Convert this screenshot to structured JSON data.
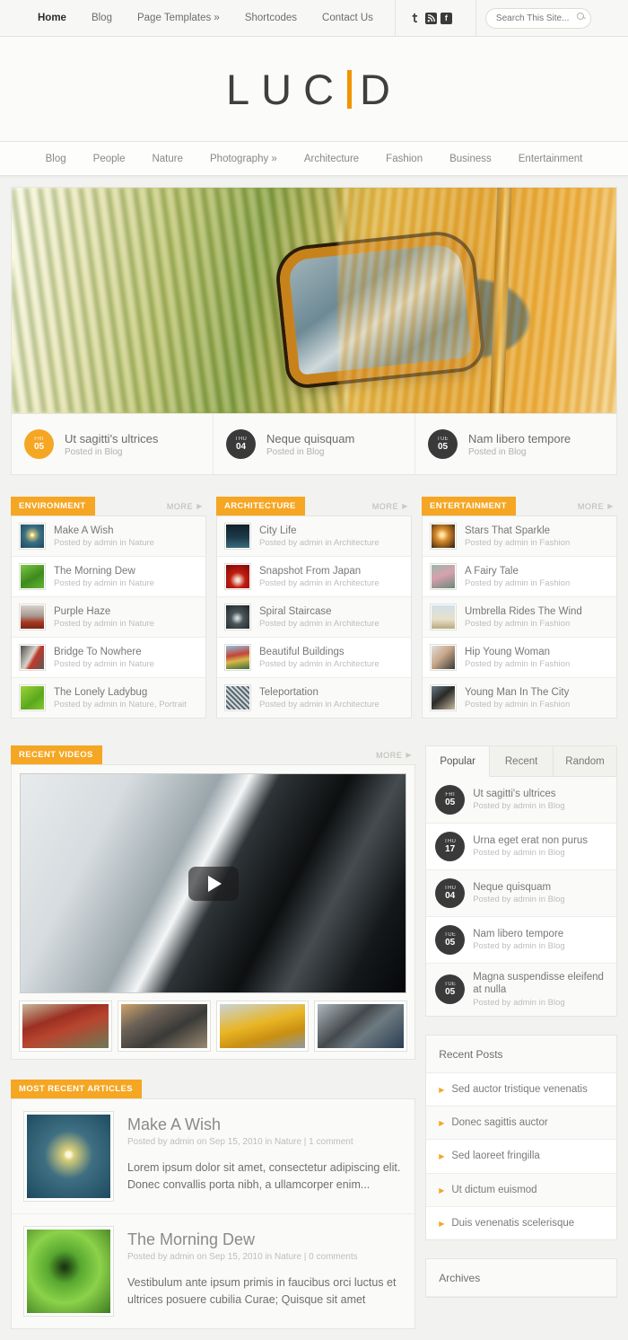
{
  "topnav": {
    "items": [
      {
        "label": "Home",
        "active": true
      },
      {
        "label": "Blog",
        "active": false
      },
      {
        "label": "Page Templates »",
        "active": false
      },
      {
        "label": "Shortcodes",
        "active": false
      },
      {
        "label": "Contact Us",
        "active": false
      }
    ],
    "social": [
      "twitter-icon",
      "rss-icon",
      "facebook-icon"
    ],
    "social_glyphs": [
      "t",
      "◤",
      "f"
    ]
  },
  "search": {
    "placeholder": "Search This Site...",
    "value": ""
  },
  "logo": {
    "before": "LUC",
    "after": "D",
    "bar": "I",
    "accent": "#f29400"
  },
  "catnav": {
    "items": [
      "Blog",
      "People",
      "Nature",
      "Photography »",
      "Architecture",
      "Fashion",
      "Business",
      "Entertainment"
    ]
  },
  "hero": {
    "alt": "car-side-mirror-motion-blur"
  },
  "featured": [
    {
      "day": "FRI",
      "num": "05",
      "title": "Ut sagitti's ultrices",
      "sub": "Posted in Blog",
      "accent": true
    },
    {
      "day": "THU",
      "num": "04",
      "title": "Neque quisquam",
      "sub": "Posted in Blog",
      "accent": false
    },
    {
      "day": "TUE",
      "num": "05",
      "title": "Nam libero tempore",
      "sub": "Posted in Blog",
      "accent": false
    }
  ],
  "columns": [
    {
      "badge": "ENVIRONMENT",
      "more": "MORE",
      "rows": [
        {
          "title": "Make A Wish",
          "sub": "Posted by admin in Nature"
        },
        {
          "title": "The Morning Dew",
          "sub": "Posted by admin in Nature"
        },
        {
          "title": "Purple Haze",
          "sub": "Posted by admin in Nature"
        },
        {
          "title": "Bridge To Nowhere",
          "sub": "Posted by admin in Nature"
        },
        {
          "title": "The Lonely Ladybug",
          "sub": "Posted by admin in Nature, Portrait"
        }
      ]
    },
    {
      "badge": "ARCHITECTURE",
      "more": "MORE",
      "rows": [
        {
          "title": "City Life",
          "sub": "Posted by admin in Architecture"
        },
        {
          "title": "Snapshot From Japan",
          "sub": "Posted by admin in Architecture"
        },
        {
          "title": "Spiral Staircase",
          "sub": "Posted by admin in Architecture"
        },
        {
          "title": "Beautiful Buildings",
          "sub": "Posted by admin in Architecture"
        },
        {
          "title": "Teleportation",
          "sub": "Posted by admin in Architecture"
        }
      ]
    },
    {
      "badge": "ENTERTAINMENT",
      "more": "MORE",
      "rows": [
        {
          "title": "Stars That Sparkle",
          "sub": "Posted by admin in Fashion"
        },
        {
          "title": "A Fairy Tale",
          "sub": "Posted by admin in Fashion"
        },
        {
          "title": "Umbrella Rides The Wind",
          "sub": "Posted by admin in Fashion"
        },
        {
          "title": "Hip Young Woman",
          "sub": "Posted by admin in Fashion"
        },
        {
          "title": "Young Man In The City",
          "sub": "Posted by admin in Fashion"
        }
      ]
    }
  ],
  "videos": {
    "badge": "RECENT VIDEOS",
    "more": "MORE",
    "thumbs": [
      "red-classic-car",
      "bronze-sedan",
      "yellow-sportscar",
      "car-headlight"
    ]
  },
  "tabs": {
    "items": [
      {
        "label": "Popular",
        "active": true
      },
      {
        "label": "Recent",
        "active": false
      },
      {
        "label": "Random",
        "active": false
      }
    ],
    "rows": [
      {
        "day": "FRI",
        "num": "05",
        "title": "Ut sagitti's ultrices",
        "sub": "Posted by admin in Blog"
      },
      {
        "day": "THU",
        "num": "17",
        "title": "Urna eget erat non purus",
        "sub": "Posted by admin in Blog"
      },
      {
        "day": "THU",
        "num": "04",
        "title": "Neque quisquam",
        "sub": "Posted by admin in Blog"
      },
      {
        "day": "TUE",
        "num": "05",
        "title": "Nam libero tempore",
        "sub": "Posted by admin in Blog"
      },
      {
        "day": "TUE",
        "num": "05",
        "title": "Magna suspendisse eleifend at nulla",
        "sub": "Posted by admin in Blog"
      }
    ]
  },
  "recent_posts": {
    "title": "Recent Posts",
    "items": [
      "Sed auctor tristique venenatis",
      "Donec sagittis auctor",
      "Sed laoreet fringilla",
      "Ut dictum euismod",
      "Duis venenatis scelerisque"
    ]
  },
  "archives": {
    "title": "Archives"
  },
  "articles": {
    "badge": "MOST RECENT ARTICLES",
    "items": [
      {
        "title": "Make A Wish",
        "meta": "Posted by admin on Sep 15, 2010 in Nature | 1 comment",
        "body": "Lorem ipsum dolor sit amet, consectetur adipiscing elit. Donec convallis porta nibh, a ullamcorper enim..."
      },
      {
        "title": "The Morning Dew",
        "meta": "Posted by admin on Sep 15, 2010 in Nature | 0 comments",
        "body": "Vestibulum ante ipsum primis in faucibus orci luctus et ultrices posuere cubilia Curae; Quisque sit amet"
      }
    ]
  }
}
